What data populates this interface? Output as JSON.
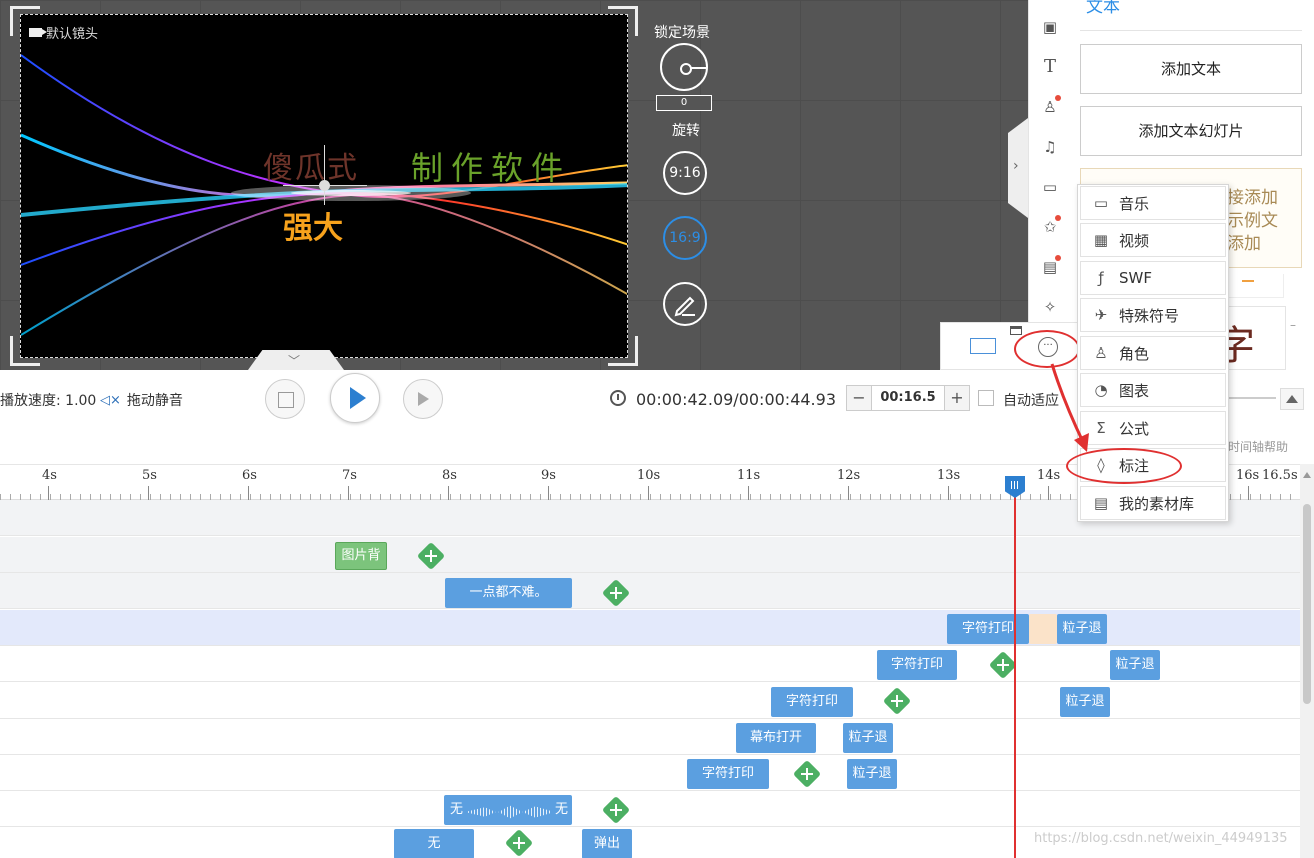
{
  "preview": {
    "camera_label": "默认镜头",
    "title_left": "傻瓜式",
    "title_right": "制作软件",
    "title_strong": "强大"
  },
  "stage_controls": {
    "lock_label": "锁定场景",
    "angle_value": "0",
    "rotate_label": "旋转",
    "ratio_916": "9:16",
    "ratio_169": "16:9"
  },
  "right_panel": {
    "title": "文本",
    "add_text": "添加文本",
    "add_text_slide": "添加文本幻灯片",
    "hint_lines": [
      "接添加",
      "示例文",
      "添加"
    ],
    "thumb_char": "字"
  },
  "menu": {
    "items": [
      {
        "label": "音乐",
        "icon": "folder-icon"
      },
      {
        "label": "视频",
        "icon": "film-icon"
      },
      {
        "label": "SWF",
        "icon": "swf-icon"
      },
      {
        "label": "特殊符号",
        "icon": "airplane-icon"
      },
      {
        "label": "角色",
        "icon": "character-icon"
      },
      {
        "label": "图表",
        "icon": "pie-chart-icon"
      },
      {
        "label": "公式",
        "icon": "sigma-icon"
      },
      {
        "label": "标注",
        "icon": "drop-icon"
      },
      {
        "label": "我的素材库",
        "icon": "library-icon"
      }
    ]
  },
  "playback": {
    "speed": "播放速度: 1.00",
    "mute": "拖动静音",
    "timecode": "00:00:42.09/00:00:44.93",
    "zoom_value": "00:16.5",
    "zoom_minus": "−",
    "zoom_plus": "+",
    "auto_fit": "自动适应",
    "timeline_help": "时间轴帮助"
  },
  "ruler": {
    "labels": [
      "4s",
      "5s",
      "6s",
      "7s",
      "8s",
      "9s",
      "10s",
      "11s",
      "12s",
      "13s",
      "14s",
      "16s",
      "16.5s"
    ]
  },
  "tracks": {
    "clips": [
      "图片背",
      "一点都不难。",
      "字符打印",
      "粒子退",
      "字符打印",
      "粒子退",
      "字符打印",
      "粒子退",
      "幕布打开",
      "粒子退",
      "字符打印",
      "粒子退",
      "无",
      "无",
      "无",
      "弹出"
    ]
  },
  "watermark": "https://blog.csdn.net/weixin_44949135"
}
